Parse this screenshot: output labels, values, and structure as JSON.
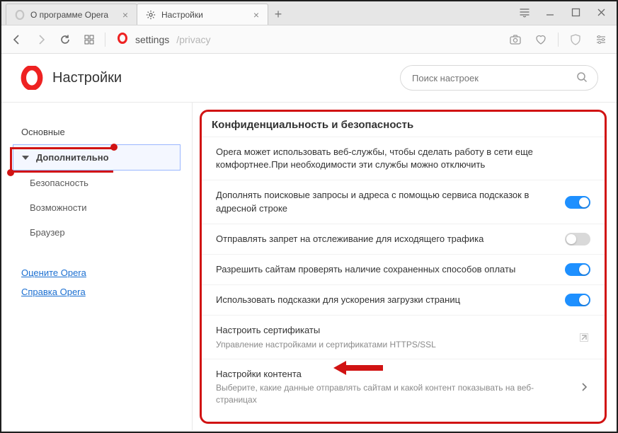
{
  "tabs": [
    {
      "title": "О программе Opera"
    },
    {
      "title": "Настройки"
    }
  ],
  "address": {
    "path": "settings",
    "sub": "/privacy"
  },
  "header": {
    "title": "Настройки"
  },
  "search": {
    "placeholder": "Поиск настроек"
  },
  "sidebar": {
    "basic": "Основные",
    "advanced": "Дополнительно",
    "security": "Безопасность",
    "features": "Возможности",
    "browser": "Браузер",
    "rate": "Оцените Opera",
    "help": "Справка Opera"
  },
  "section": {
    "title": "Конфиденциальность и безопасность",
    "intro": "Opera может использовать веб-службы, чтобы сделать работу в сети еще комфортнее.При необходимости эти службы можно отключить",
    "rows": {
      "suggest": "Дополнять поисковые запросы и адреса с помощью сервиса подсказок в адресной строке",
      "dnt": "Отправлять запрет на отслеживание для исходящего трафика",
      "pay": "Разрешить сайтам проверять наличие сохраненных способов оплаты",
      "preload": "Использовать подсказки для ускорения загрузки страниц",
      "cert": "Настроить сертификаты",
      "cert_sub": "Управление настройками и сертификатами HTTPS/SSL",
      "content": "Настройки контента",
      "content_sub": "Выберите, какие данные отправлять сайтам и какой контент показывать на веб-страницах"
    }
  }
}
